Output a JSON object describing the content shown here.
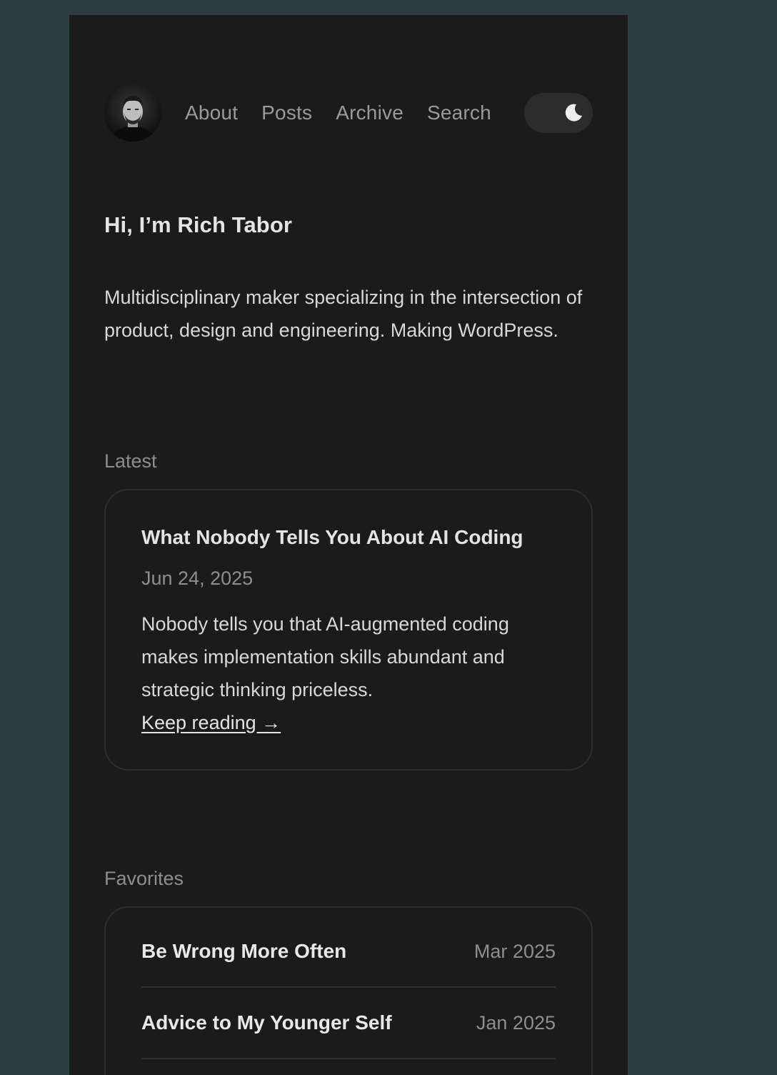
{
  "header": {
    "nav": [
      {
        "label": "About"
      },
      {
        "label": "Posts"
      },
      {
        "label": "Archive"
      },
      {
        "label": "Search"
      }
    ],
    "toggle_icon": "moon-icon"
  },
  "intro": {
    "title": "Hi, I’m Rich Tabor",
    "text": "Multidisciplinary maker specializing in the intersection of product, design and engineering. Making WordPress."
  },
  "latest": {
    "label": "Latest",
    "post": {
      "title": "What Nobody Tells You About AI Coding",
      "date": "Jun 24, 2025",
      "excerpt": "Nobody tells you that AI-augmented coding makes implementation skills abundant and strategic thinking priceless.",
      "link_label": "Keep reading →"
    }
  },
  "favorites": {
    "label": "Favorites",
    "items": [
      {
        "title": "Be Wrong More Often",
        "date": "Mar 2025"
      },
      {
        "title": "Advice to My Younger Self",
        "date": "Jan 2025"
      }
    ]
  },
  "colors": {
    "outer_background": "#2d3d42",
    "page_background": "#1b1b1b",
    "card_border": "#2e2e2e",
    "muted_text": "#8e8e8e",
    "primary_text": "#e4e4e4"
  }
}
